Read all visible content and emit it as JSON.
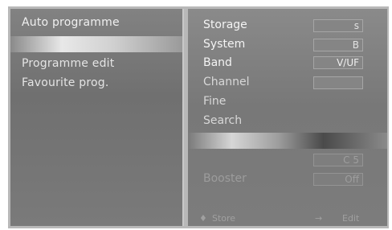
{
  "menu": {
    "items": [
      {
        "label": "Auto programme"
      },
      {
        "label": "Programme edit"
      },
      {
        "label": "Favourite prog."
      }
    ]
  },
  "settings": {
    "rows": [
      {
        "label": "Storage",
        "value": "s"
      },
      {
        "label": "System",
        "value": "B"
      },
      {
        "label": "Band",
        "value": "V/UF"
      },
      {
        "label": "Channel",
        "value": ""
      },
      {
        "label": "Fine",
        "value": ""
      },
      {
        "label": "Search",
        "value": ""
      }
    ],
    "lower": [
      {
        "label": "",
        "value": "C 5"
      },
      {
        "label": "Booster",
        "value": "Off"
      }
    ]
  },
  "footer": {
    "left_symbol": "♦",
    "left_label": "Store",
    "right_symbol": "→",
    "right_label": "Edit"
  }
}
